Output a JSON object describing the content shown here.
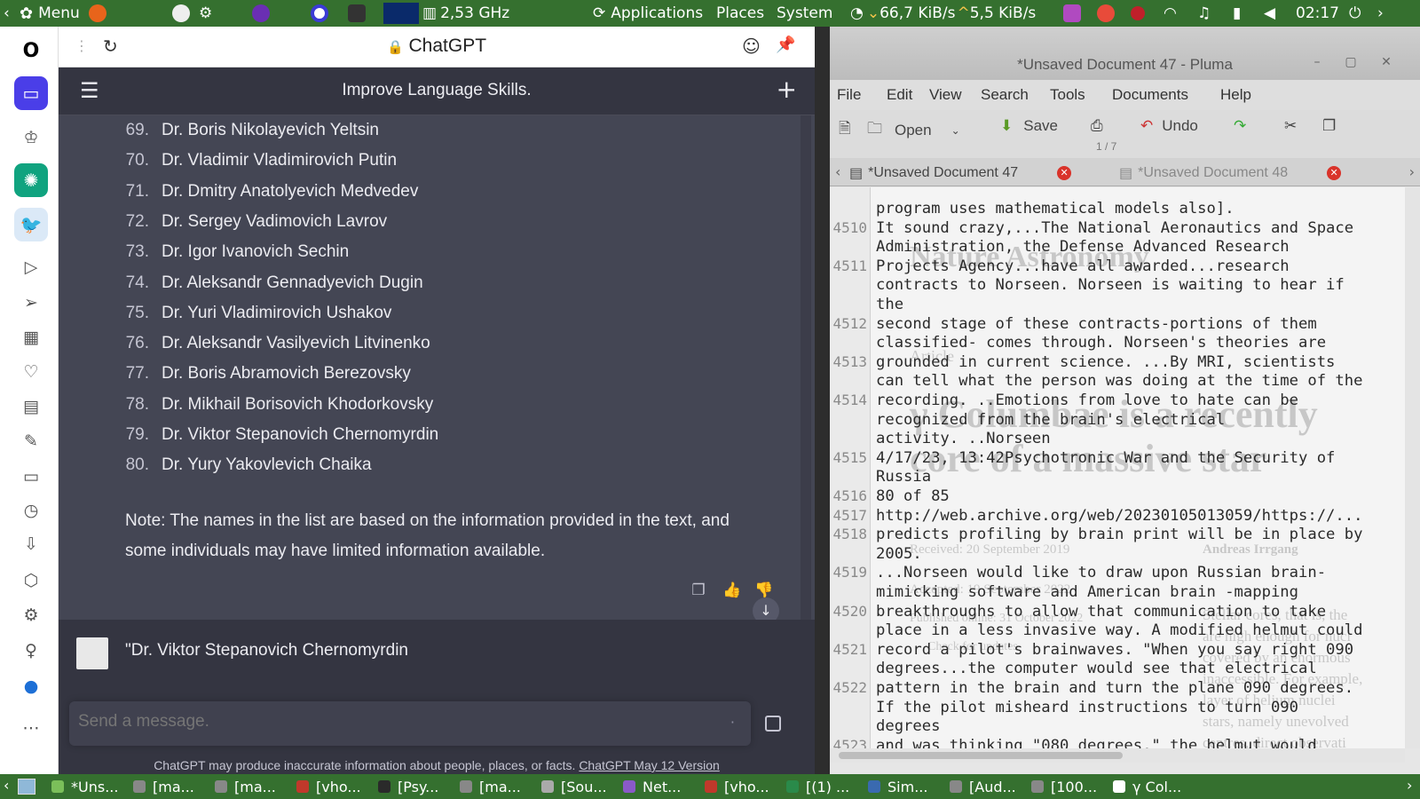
{
  "top_panel": {
    "menu_label": "Menu",
    "cpu_freq": "2,53 GHz",
    "applications": "Applications",
    "places": "Places",
    "system": "System",
    "net_down": "66,7 KiB/s",
    "net_up": "5,5 KiB/s",
    "clock": "02:17"
  },
  "browser": {
    "tab_title": "ChatGPT",
    "chat_title": "Improve Language Skills.",
    "list_items": [
      {
        "num": "69.",
        "name": "Dr. Boris Nikolayevich Yeltsin"
      },
      {
        "num": "70.",
        "name": "Dr. Vladimir Vladimirovich Putin"
      },
      {
        "num": "71.",
        "name": "Dr. Dmitry Anatolyevich Medvedev"
      },
      {
        "num": "72.",
        "name": "Dr. Sergey Vadimovich Lavrov"
      },
      {
        "num": "73.",
        "name": "Dr. Igor Ivanovich Sechin"
      },
      {
        "num": "74.",
        "name": "Dr. Aleksandr Gennadyevich Dugin"
      },
      {
        "num": "75.",
        "name": "Dr. Yuri Vladimirovich Ushakov"
      },
      {
        "num": "76.",
        "name": "Dr. Aleksandr Vasilyevich Litvinenko"
      },
      {
        "num": "77.",
        "name": "Dr. Boris Abramovich Berezovsky"
      },
      {
        "num": "78.",
        "name": "Dr. Mikhail Borisovich Khodorkovsky"
      },
      {
        "num": "79.",
        "name": "Dr. Viktor Stepanovich Chernomyrdin"
      },
      {
        "num": "80.",
        "name": "Dr. Yury Yakovlevich Chaika"
      }
    ],
    "note": "Note: The names in the list are based on the information provided in the text, and some individuals may have limited information available.",
    "user_message": "\"Dr. Viktor Stepanovich Chernomyrdin",
    "composer_placeholder": "Send a message.",
    "disclaimer": "ChatGPT may produce inaccurate information about people, places, or facts.",
    "disclaimer_link": "ChatGPT May 12 Version"
  },
  "pluma": {
    "title": "*Unsaved Document 47 - Pluma",
    "menu": [
      "File",
      "Edit",
      "View",
      "Search",
      "Tools",
      "Documents",
      "Help"
    ],
    "toolbar": {
      "open": "Open",
      "save": "Save",
      "undo": "Undo"
    },
    "page_indicator": "1 / 7",
    "tabs": [
      "*Unsaved Document 47",
      "*Unsaved Document 48"
    ],
    "lines": [
      {
        "ln": "",
        "text": "program uses mathematical models also]."
      },
      {
        "ln": "4510",
        "text": "It sound crazy,...The National Aeronautics and Space"
      },
      {
        "ln": "",
        "text": "Administration, the Defense Advanced Research"
      },
      {
        "ln": "4511",
        "text": "Projects Agency...have all awarded...research"
      },
      {
        "ln": "",
        "text": "contracts to Norseen. Norseen is waiting to hear if"
      },
      {
        "ln": "",
        "text": "the"
      },
      {
        "ln": "4512",
        "text": "second stage of these contracts-portions of them"
      },
      {
        "ln": "",
        "text": "classified- comes through. Norseen's theories are"
      },
      {
        "ln": "4513",
        "text": "grounded in current science. ...By MRI, scientists"
      },
      {
        "ln": "",
        "text": "can tell what the person was doing at the time of the"
      },
      {
        "ln": "4514",
        "text": "recording. ..Emotions from love to hate can be"
      },
      {
        "ln": "",
        "text": "recognized from the brain's electrical"
      },
      {
        "ln": "",
        "text": "activity. ..Norseen"
      },
      {
        "ln": "4515",
        "text": "4/17/23, 13:42Psychotronic War and the Security of"
      },
      {
        "ln": "",
        "text": "Russia"
      },
      {
        "ln": "4516",
        "text": "80 of 85"
      },
      {
        "ln": "4517",
        "text": "http://web.archive.org/web/20230105013059/https://..."
      },
      {
        "ln": "4518",
        "text": "predicts profiling by brain print will be in place by"
      },
      {
        "ln": "",
        "text": "2005."
      },
      {
        "ln": "4519",
        "text": "...Norseen would like to draw upon Russian brain-"
      },
      {
        "ln": "",
        "text": "mimicking software and American brain -mapping"
      },
      {
        "ln": "4520",
        "text": "breakthroughs to allow that communication to take"
      },
      {
        "ln": "",
        "text": "place in a less invasive way. A modified helmut could"
      },
      {
        "ln": "4521",
        "text": "record a pilot's brainwaves. \"When you say right 090"
      },
      {
        "ln": "",
        "text": "degrees...the computer would see that electrical"
      },
      {
        "ln": "4522",
        "text": "pattern in the brain and turn the plane 090 degrees."
      },
      {
        "ln": "",
        "text": "If the pilot misheard instructions to turn 090"
      },
      {
        "ln": "",
        "text": "degrees"
      },
      {
        "ln": "4523",
        "text": "and was thinking \"080 degrees,\" the helmut would"
      }
    ],
    "ghost_heading": "Nature Astronomy",
    "ghost_article": "Article",
    "ghost_big1": "γ Columbae is a recently",
    "ghost_big2": "core of a massive star",
    "ghost_received": "Received: 20 September 2019",
    "ghost_accepted": "Accepted: 19 September 2022",
    "ghost_published": "Published online: 31 October 2022",
    "ghost_check": "Check for updates",
    "ghost_author": "Andreas Irrgang",
    "ghost_side": [
      "Stellar cores, that is, the",
      "are high enough for nucl",
      "covered by an enormous",
      "inaccessible. For example,",
      "layer of helium nuclei",
      "stars, namely unevolved",
      "centres, direct observati"
    ]
  },
  "taskbar": {
    "tasks": [
      "*Uns...",
      "[ma...",
      "[ma...",
      "[vho...",
      "[Psy...",
      "[ma...",
      "[Sou...",
      "Net...",
      "[vho...",
      "[(1) ...",
      "Sim...",
      "[Aud...",
      "[100...",
      "γ Col..."
    ]
  }
}
